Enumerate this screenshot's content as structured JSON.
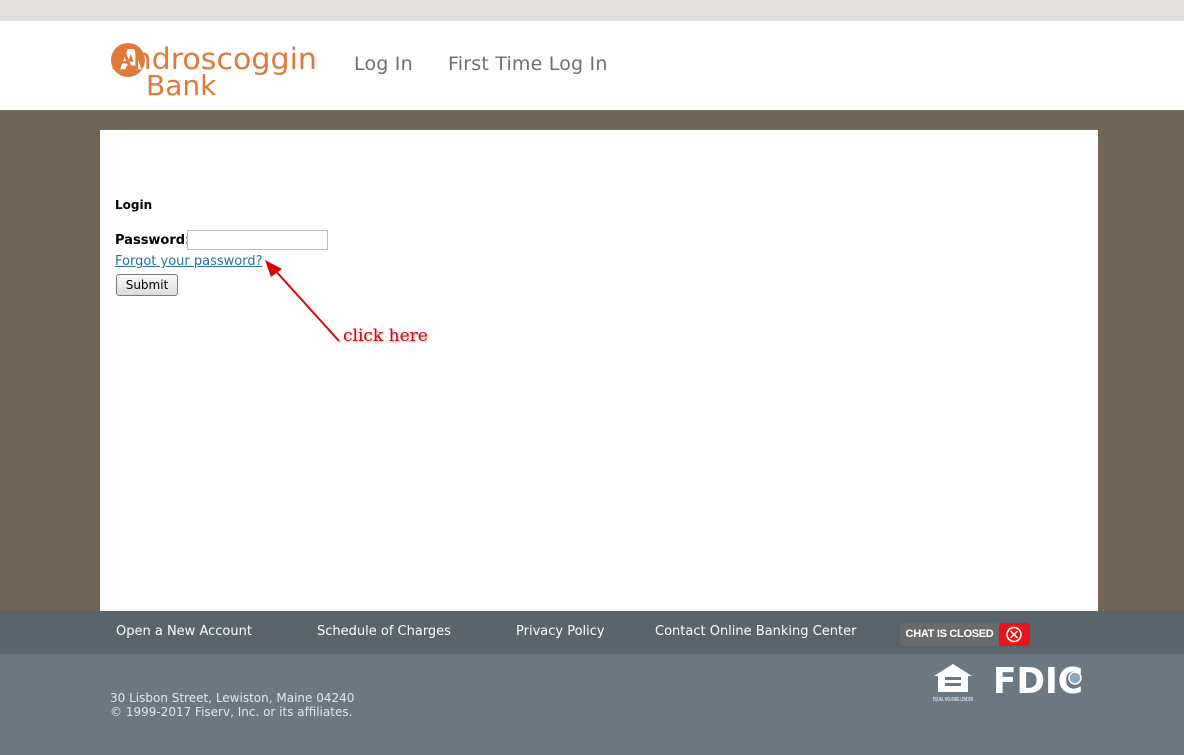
{
  "header": {
    "brand_line1": "Androscoggin",
    "brand_line2": "Bank",
    "nav": [
      "Log In",
      "First Time Log In"
    ]
  },
  "login": {
    "title": "Login",
    "password_label": "Password:",
    "password_value": "",
    "forgot_link": "Forgot your password?",
    "submit_label": "Submit"
  },
  "annotation": {
    "text": "click here"
  },
  "footer": {
    "links": [
      "Open a New Account",
      "Schedule of Charges",
      "Privacy Policy",
      "Contact Online Banking Center"
    ],
    "chat_status": "CHAT IS CLOSED",
    "address": "30 Lisbon Street, Lewiston, Maine 04240",
    "copyright": "© 1999-2017 Fiserv, Inc. or its affiliates.",
    "ehl_text": "EQUAL HOUSING LENDER",
    "fdic_text": "FDIC"
  },
  "colors": {
    "brand_orange": "#e07a3a",
    "page_bg": "#736555",
    "footer_nav_bg": "#5a646b",
    "footer_bg": "#6b7882",
    "link_blue": "#2a6f9b",
    "annotation_red": "#e00000",
    "chat_red": "#e8141b"
  }
}
